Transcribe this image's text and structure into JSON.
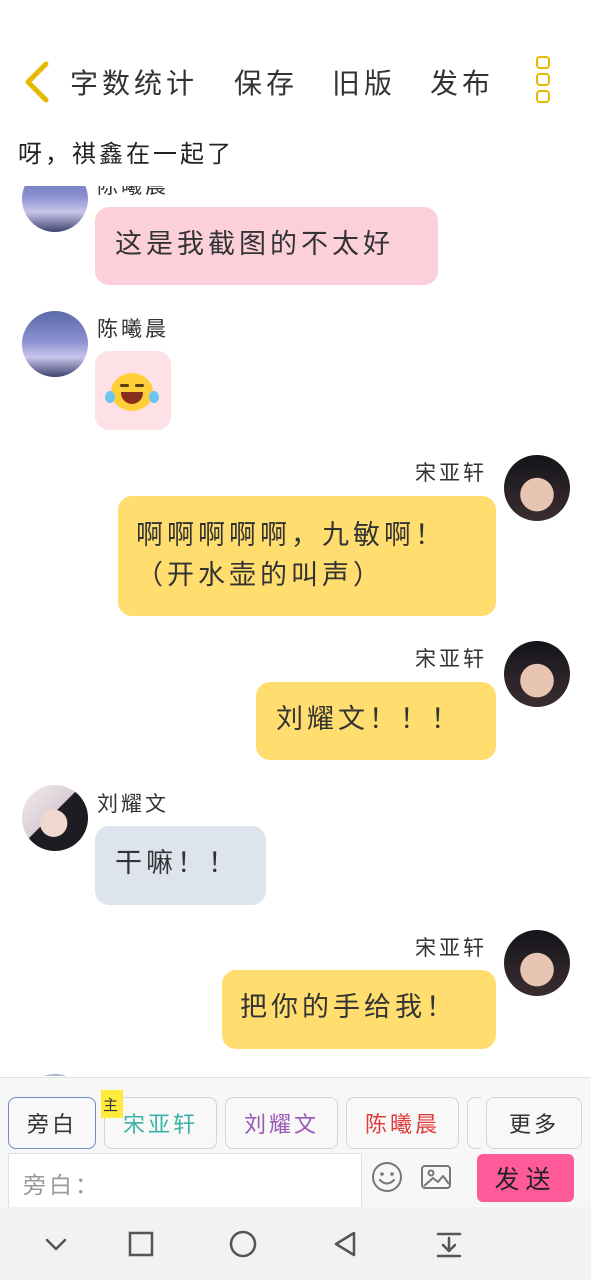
{
  "header": {
    "back_icon": "chevron-left-icon",
    "items": [
      "字数统计",
      "保存",
      "旧版",
      "发布"
    ],
    "more_icon": "more-vertical-icon",
    "accent": "#e6b800"
  },
  "story_title": "呀，祺鑫在一起了",
  "messages": [
    {
      "speaker": "陈曦晨",
      "side": "left",
      "text": "这是我截图的不太好"
    },
    {
      "speaker": "陈曦晨",
      "side": "left",
      "text": "",
      "emoji": "laughing-crying-emoji-icon"
    },
    {
      "speaker": "宋亚轩",
      "side": "right",
      "text": "啊啊啊啊啊，九敏啊！（开水壶的叫声）"
    },
    {
      "speaker": "宋亚轩",
      "side": "right",
      "text": "刘耀文！！！"
    },
    {
      "speaker": "刘耀文",
      "side": "left",
      "text": "干嘛！！"
    },
    {
      "speaker": "宋亚轩",
      "side": "right",
      "text": "把你的手给我！"
    }
  ],
  "roles": [
    {
      "label": "旁白",
      "color": "#333333"
    },
    {
      "label": "宋亚轩",
      "color": "#3bb3a6",
      "badge": "主"
    },
    {
      "label": "刘耀文",
      "color": "#9b59b6"
    },
    {
      "label": "陈曦晨",
      "color": "#e03b3b"
    },
    {
      "label": "更多",
      "color": "#333333"
    }
  ],
  "composer": {
    "placeholder": "旁白：",
    "send_label": "发送",
    "send_color": "#ff5a9a"
  },
  "bubble_colors": {
    "pink": "#fbd0db",
    "yellow": "#ffdd6e",
    "grey": "#dde4ee"
  }
}
